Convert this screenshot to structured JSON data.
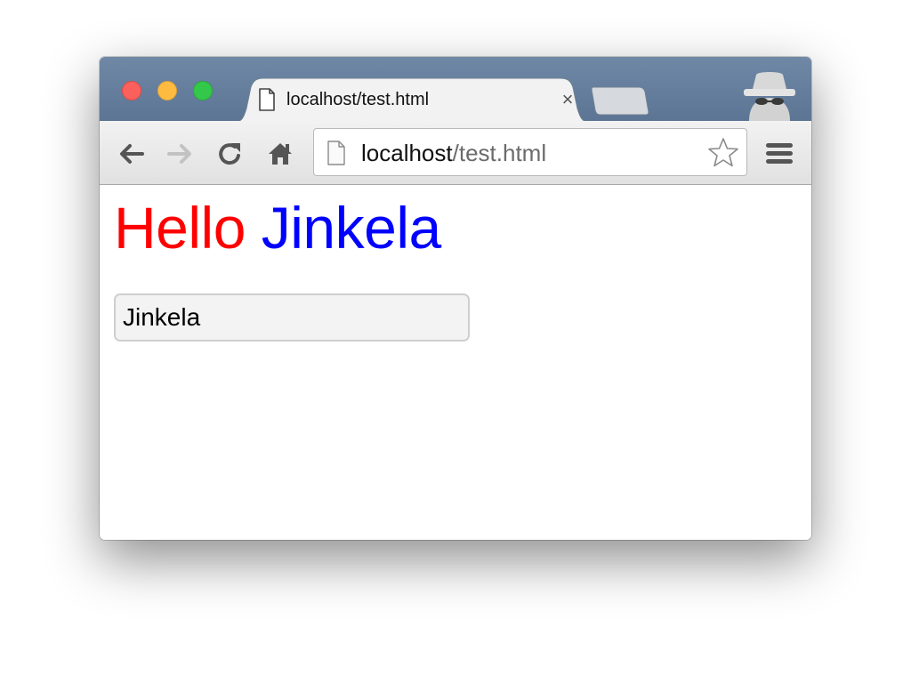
{
  "tab": {
    "title": "localhost/test.html",
    "close_glyph": "×",
    "favicon": "file-icon"
  },
  "omnibox": {
    "host": "localhost",
    "path": "/test.html",
    "page_icon": "file-icon",
    "bookmark_icon": "star-icon"
  },
  "toolbar": {
    "back_icon": "back-arrow-icon",
    "forward_icon": "forward-arrow-icon",
    "reload_icon": "reload-icon",
    "home_icon": "home-icon",
    "menu_icon": "hamburger-menu-icon"
  },
  "page": {
    "heading_part1": "Hello",
    "heading_part2": "Jinkela",
    "heading_color1": "#ff0000",
    "heading_color2": "#0000ff",
    "input_value": "Jinkela"
  },
  "colors": {
    "titlebar": "#6480a0",
    "close": "#fc605c",
    "minimize": "#fdbc40",
    "maximize": "#34c84a"
  },
  "incognito_icon": "incognito-spy-icon"
}
